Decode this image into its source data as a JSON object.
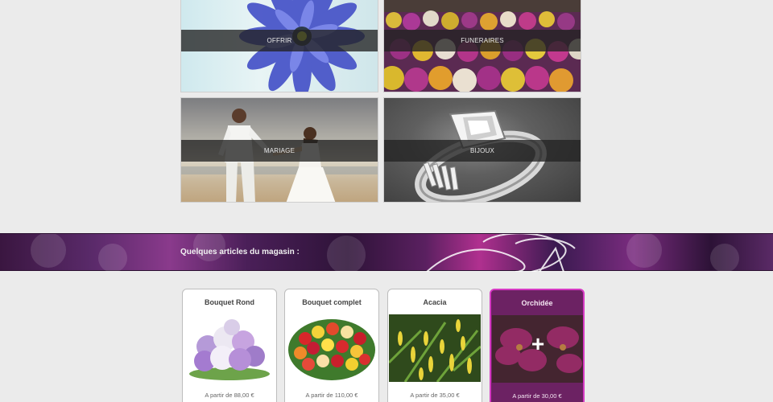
{
  "categories": [
    {
      "label": "OFFRIR"
    },
    {
      "label": "FUNERAIRES"
    },
    {
      "label": "MARIAGE"
    },
    {
      "label": "BIJOUX"
    }
  ],
  "banner": {
    "title": "Quelques articles du magasin :"
  },
  "products": [
    {
      "name": "Bouquet Rond",
      "price": "A partir de 88,00 €"
    },
    {
      "name": "Bouquet complet",
      "price": "A partir de 110,00 €"
    },
    {
      "name": "Acacia",
      "price": "A partir de 35,00 €"
    },
    {
      "name": "Orchidée",
      "price": "A partir de 30,00 €",
      "hover_icon": "plus-icon"
    }
  ],
  "colors": {
    "page_bg": "#ebebeb",
    "accent": "#d63ac3",
    "active_card_bg": "#6c2263"
  }
}
